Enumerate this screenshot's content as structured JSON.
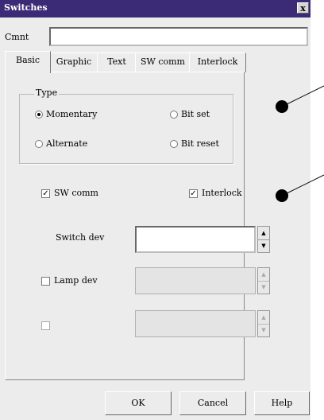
{
  "window": {
    "title": "Switches",
    "close_label": "x"
  },
  "comment": {
    "label": "Cmnt",
    "value": ""
  },
  "tabs": [
    {
      "label": "Basic",
      "active": true
    },
    {
      "label": "Graphic",
      "active": false
    },
    {
      "label": "Text",
      "active": false
    },
    {
      "label": "SW comm",
      "active": false
    },
    {
      "label": "Interlock",
      "active": false
    }
  ],
  "type_group": {
    "label": "Type",
    "options": [
      {
        "label": "Momentary",
        "selected": true
      },
      {
        "label": "Bit set",
        "selected": false
      },
      {
        "label": "Alternate",
        "selected": false
      },
      {
        "label": "Bit reset",
        "selected": false
      }
    ]
  },
  "sw_comm": {
    "label": "SW comm",
    "checked": true
  },
  "interlock": {
    "label": "Interlock",
    "checked": true
  },
  "switch_dev": {
    "label": "Switch dev",
    "value": ""
  },
  "lamp_dev": {
    "label": "Lamp dev",
    "checked": false,
    "value": ""
  },
  "third_dev": {
    "label": "",
    "checked": false,
    "value": ""
  },
  "buttons": {
    "ok": "OK",
    "cancel": "Cancel",
    "help": "Help"
  }
}
